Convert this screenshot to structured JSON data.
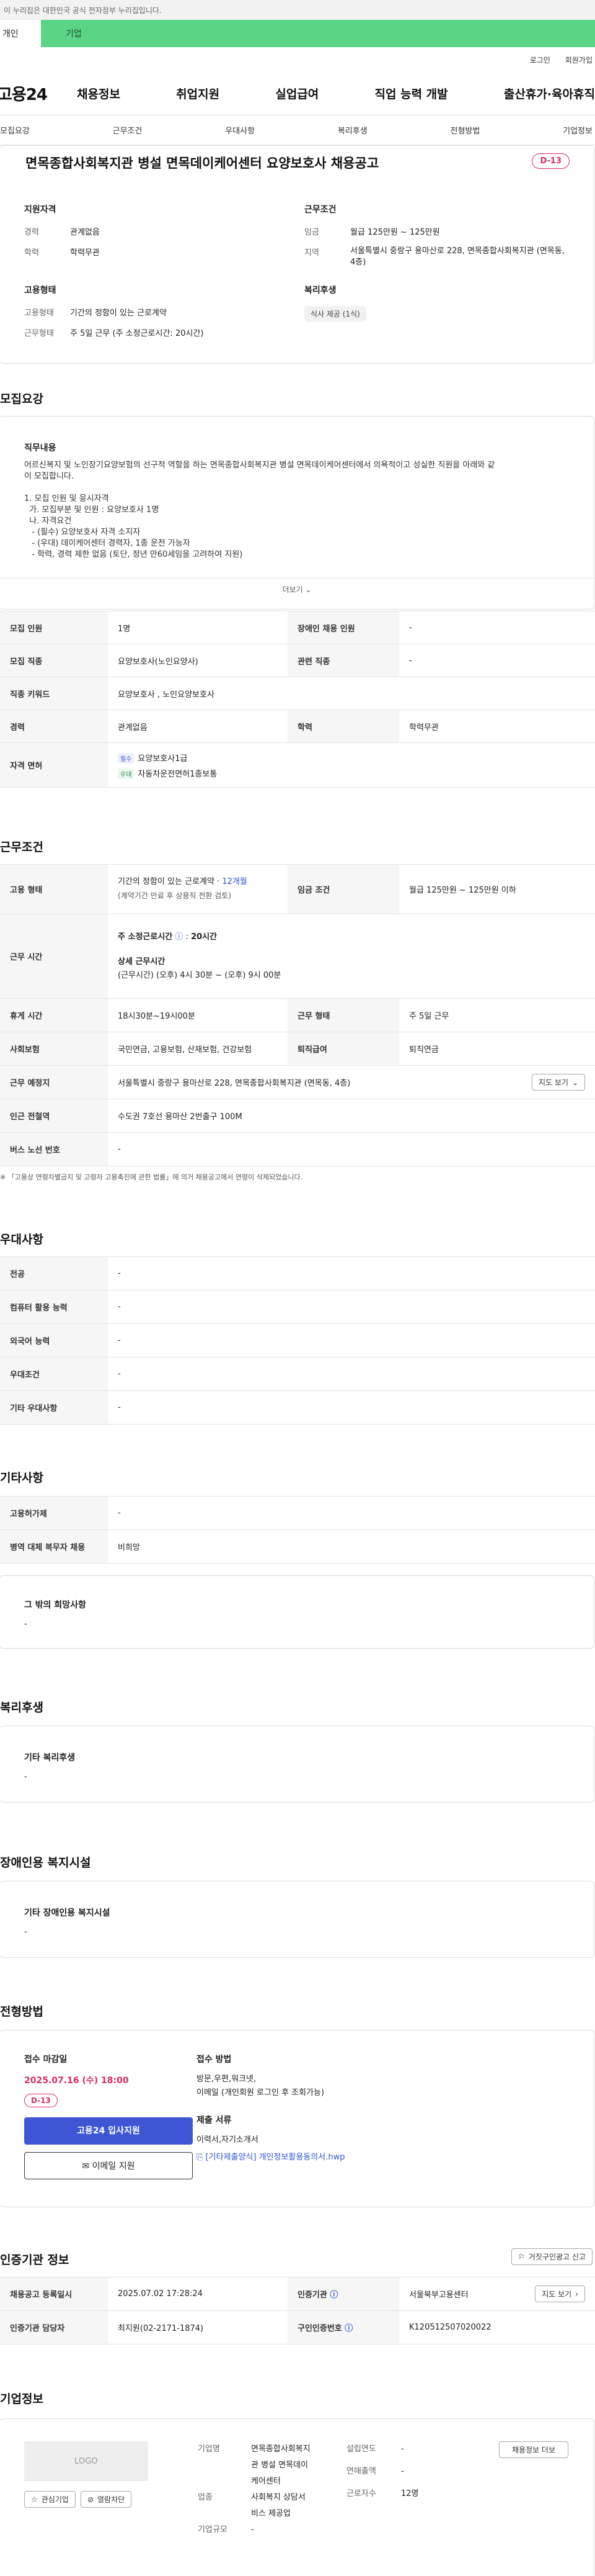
{
  "gov_bar": "이 누리집은 대한민국 공식 전자정부 누리집입니다.",
  "top_tabs": [
    "개인",
    "기업"
  ],
  "util": [
    "로그인",
    "회원가입"
  ],
  "logo": "고용24",
  "gnb": [
    "채용정보",
    "취업지원",
    "실업급여",
    "직업 능력 개발",
    "출산휴가·육아휴직"
  ],
  "subnav": [
    "모집요강",
    "근무조건",
    "우대사항",
    "복리후생",
    "전형방법",
    "기업정보"
  ],
  "summary": {
    "title": "면목종합사회복지관 병설 면목데이케어센터 요양보호사 채용공고",
    "dday": "D-13",
    "qual_head": "지원자격",
    "qual": [
      {
        "k": "경력",
        "v": "관계없음"
      },
      {
        "k": "학력",
        "v": "학력무관"
      }
    ],
    "work_head": "근무조건",
    "work": [
      {
        "k": "임금",
        "v": "월급 125만원 ~ 125만원"
      },
      {
        "k": "지역",
        "v": "서울특별시 중랑구 용마산로 228, 면목종합사회복지관 (면목동, 4층)"
      }
    ],
    "emp_head": "고용형태",
    "emp": [
      {
        "k": "고용형태",
        "v": "기간의 정함이 있는 근로계약"
      },
      {
        "k": "근무형태",
        "v": "주 5일 근무 (주 소정근로시간: 20시간)"
      }
    ],
    "welfare_head": "복리후생",
    "welfare_pill": "식사 제공 (1식)"
  },
  "recruit": {
    "title": "모집요강",
    "box_head": "직무내용",
    "lines": [
      "어르신복지 및 노인장기요양보험의 선구적 역할을 하는 면목종합사회복지관 병설 면목데이케어센터에서 의욕적이고 성실한 직원을 아래와 같",
      "이 모집합니다.",
      "",
      "1. 모집 인원 및 응시자격",
      "  가. 모집부분 및 인원 : 요양보호사 1명",
      "  나. 자격요건",
      "   - (필수) 요양보호사 자격 소지자",
      "   - (우대) 데이케어센터 경력자, 1종 운전 가능자",
      "   - 학력, 경력 제한 없음 (토단, 정년 만60세임을 고려하여 지원)"
    ],
    "more": "더보기",
    "rows": [
      {
        "th": "모집 인원",
        "td": "1명",
        "th2": "장애인 채용 인원",
        "td2": "-"
      },
      {
        "th": "모집 직종",
        "td": "요양보호사(노인요양사)",
        "th2": "관련 직종",
        "td2": "-"
      },
      {
        "th": "직종 키워드",
        "td": "요양보호사 , 노인요양보호사"
      },
      {
        "th": "경력",
        "td": "관계없음",
        "th2": "학력",
        "td2": "학력무관"
      }
    ],
    "license_th": "자격 면허",
    "licenses": [
      {
        "tag": "필수",
        "name": "요양보호사1급"
      },
      {
        "tag": "우대",
        "name": "자동차운전면허1종보통"
      }
    ]
  },
  "work": {
    "title": "근무조건",
    "emp_th": "고용 형태",
    "emp_v1": "기간의 정함이 있는 근로계약 · ",
    "emp_v1b": "12개월",
    "emp_v2": "(계약기간 만료 후 상용직 전환 검토)",
    "wage_th": "임금 조건",
    "wage_v": "월급 125만원 ~ 125만원 이하",
    "time_th": "근무 시간",
    "time_v1": "주 소정근로시간",
    "time_v1b": "20시간",
    "time_v2": "상세 근무시간",
    "time_v3": "(근무시간) (오후) 4시 30분 ~ (오후) 9시 00분",
    "rest_th": "휴게 시간",
    "rest_v": "18시30분~19시00분",
    "form_th": "근무 형태",
    "form_v": "주 5일 근무",
    "ins_th": "사회보험",
    "ins_v": "국민연금, 고용보험, 산재보험, 건강보험",
    "ret_th": "퇴직급여",
    "ret_v": "퇴직연금",
    "place_th": "근무 예정지",
    "place_v": "서울특별시 중랑구 용마산로 228, 면목종합사회복지관 (면목동, 4층)",
    "map_btn": "지도 보기",
    "sub_th": "인근 전철역",
    "sub_v": "수도권 7호선 용마산 2번출구 100M",
    "bus_th": "버스 노선 번호",
    "bus_v": "-",
    "note": "※ 「고용상 연령차별금지 및 고령자 고용촉진에 관한 법률」에 의거 채용공고에서 연령이 삭제되었습니다."
  },
  "pref": {
    "title": "우대사항",
    "rows": [
      {
        "th": "전공",
        "td": "-"
      },
      {
        "th": "컴퓨터 활용 능력",
        "td": "-"
      },
      {
        "th": "외국어 능력",
        "td": "-"
      },
      {
        "th": "우대조건",
        "td": "-"
      },
      {
        "th": "기타 우대사항",
        "td": "-"
      }
    ]
  },
  "etc": {
    "title": "기타사항",
    "rows": [
      {
        "th": "고용허가제",
        "td": "-"
      },
      {
        "th": "병역 대체 복무자 채용",
        "td": "비희망"
      }
    ],
    "box_head": "그 밖의 희망사항",
    "box_v": "-"
  },
  "welfare": {
    "title": "복리후생",
    "box_head": "기타 복리후생",
    "box_v": "-"
  },
  "disabled": {
    "title": "장애인용 복지시설",
    "box_head": "기타 장애인용 복지시설",
    "box_v": "-"
  },
  "process": {
    "title": "전형방법",
    "deadline_head": "접수 마감일",
    "deadline": "2025.07.16 (수) 18:00",
    "dday": "D-13",
    "apply": "고용24 입사지원",
    "email": "이메일 지원",
    "method_head": "접수 방법",
    "method_lines": [
      "방문,우편,워크넷,",
      "이메일 (개인회원 로그인 후 조회가능)"
    ],
    "docs_head": "제출 서류",
    "docs": "이력서,자기소개서",
    "file": "[기타제출양식] 개인정보활용동의서.hwp"
  },
  "agency": {
    "title": "인증기관 정보",
    "report_btn": "거짓구인광고 신고",
    "rows": [
      {
        "th": "채용공고 등록일시",
        "td": "2025.07.02 17:28:24",
        "th2": "인증기관",
        "td2": "서울북부고용센터"
      },
      {
        "th": "인증기관 담당자",
        "td": "최지원(02-2171-1874)",
        "th2": "구인인증번호",
        "td2": "K120512507020022"
      }
    ],
    "map_btn": "지도 보기"
  },
  "company": {
    "title": "기업정보",
    "logo": "LOGO",
    "fav": "관심기업",
    "block": "열람차단",
    "name_k": "기업명",
    "name_v": [
      "면목종합사회복지",
      "관 병설 면목데이",
      "케어센터"
    ],
    "ind_k": "업종",
    "ind_v": [
      "사회복지 상담서",
      "비스 제공업"
    ],
    "size_k": "기업규모",
    "size_v": "-",
    "year_k": "설립연도",
    "year_v": "-",
    "sales_k": "연매출액",
    "sales_v": "-",
    "emp_k": "근로자수",
    "emp_v": "12명",
    "recruit_btn": "채용정보 더보"
  }
}
